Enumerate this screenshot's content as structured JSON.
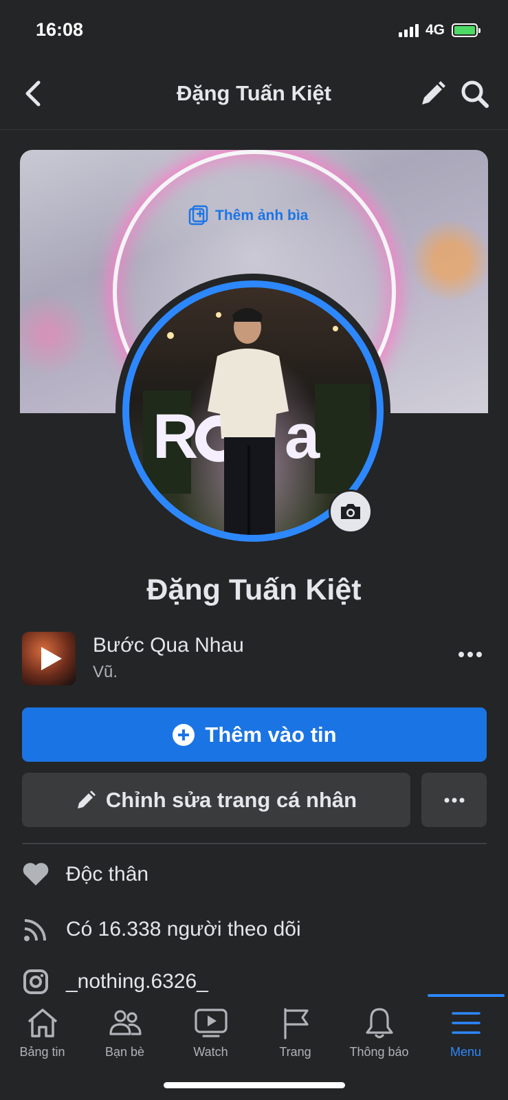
{
  "status_bar": {
    "time": "16:08",
    "network": "4G"
  },
  "header": {
    "title": "Đặng Tuấn Kiệt"
  },
  "cover": {
    "add_cover_label": "Thêm ảnh bìa"
  },
  "profile": {
    "name": "Đặng Tuấn Kiệt"
  },
  "music": {
    "song": "Bước Qua Nhau",
    "artist": "Vũ."
  },
  "actions": {
    "add_story_label": "Thêm vào tin",
    "edit_profile_label": "Chỉnh sửa trang cá nhân"
  },
  "info": [
    {
      "icon": "heart-icon",
      "text": "Độc thân"
    },
    {
      "icon": "rss-icon",
      "text": "Có 16.338 người theo dõi"
    },
    {
      "icon": "instagram-icon",
      "text": "_nothing.6326_"
    }
  ],
  "nav": [
    {
      "icon": "home-icon",
      "label": "Bảng tin",
      "active": false
    },
    {
      "icon": "friends-icon",
      "label": "Bạn bè",
      "active": false
    },
    {
      "icon": "watch-icon",
      "label": "Watch",
      "active": false
    },
    {
      "icon": "flag-icon",
      "label": "Trang",
      "active": false
    },
    {
      "icon": "bell-icon",
      "label": "Thông báo",
      "active": false
    },
    {
      "icon": "menu-icon",
      "label": "Menu",
      "active": true
    }
  ],
  "colors": {
    "accent": "#1b74e4",
    "background": "#242526",
    "secondary_button": "#3a3b3c"
  }
}
